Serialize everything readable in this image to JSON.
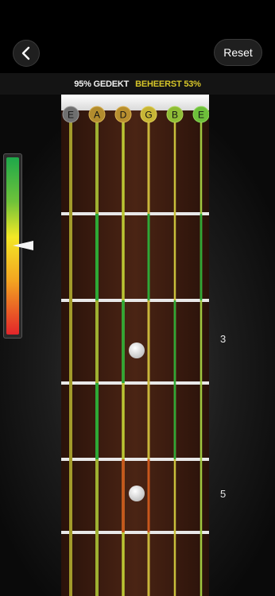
{
  "header": {
    "reset_label": "Reset"
  },
  "stats": {
    "covered": "95% GEDEKT",
    "mastered": "BEHEERST 53%"
  },
  "strings": [
    {
      "note": "E",
      "color": "#6f6f6f"
    },
    {
      "note": "A",
      "color": "#b28c2e"
    },
    {
      "note": "D",
      "color": "#b88f2f"
    },
    {
      "note": "G",
      "color": "#c7b536"
    },
    {
      "note": "B",
      "color": "#8fbd36"
    },
    {
      "note": "E",
      "color": "#6dbf3a"
    }
  ],
  "fret_labels": {
    "fret3": "3",
    "fret5": "5"
  },
  "meter": {
    "level": 0.5
  },
  "colors": {
    "background": "#000000",
    "fretboard": "#3b1a10",
    "mastered_text": "#d7c629",
    "fret_wire": "#e8e8e8"
  }
}
